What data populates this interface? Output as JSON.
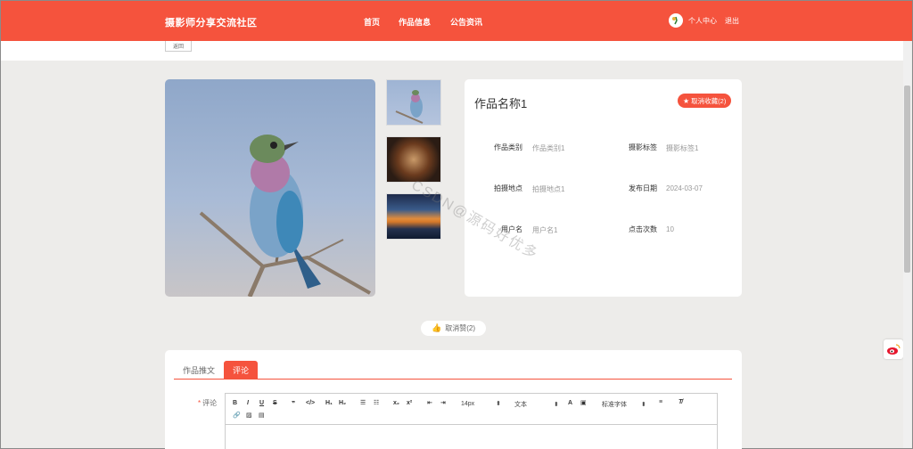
{
  "header": {
    "logo": "摄影师分享交流社区",
    "nav": [
      "首页",
      "作品信息",
      "公告资讯"
    ],
    "user_center": "个人中心",
    "logout": "退出"
  },
  "subbar": {
    "back_label": "返回"
  },
  "work": {
    "title": "作品名称1",
    "favorite_label": "取消收藏(2)",
    "fields": {
      "category_label": "作品类别",
      "category_value": "作品类别1",
      "tag_label": "摄影标签",
      "tag_value": "摄影标签1",
      "location_label": "拍摄地点",
      "location_value": "拍摄地点1",
      "date_label": "发布日期",
      "date_value": "2024-03-07",
      "user_label": "用户名",
      "user_value": "用户名1",
      "clicks_label": "点击次数",
      "clicks_value": "10"
    }
  },
  "like_button": "取消赞(2)",
  "tabs": [
    "作品推文",
    "评论"
  ],
  "comment": {
    "label": "评论",
    "toolbar": {
      "font_size": "14px",
      "text_style": "文本",
      "font_family": "标准字体"
    }
  },
  "watermark": "CSDN@源码好优多",
  "colors": {
    "primary": "#f5533d",
    "background": "#edecea"
  },
  "icons": [
    "avatar-icon",
    "star-icon",
    "thumb-up-icon",
    "weibo-icon"
  ]
}
